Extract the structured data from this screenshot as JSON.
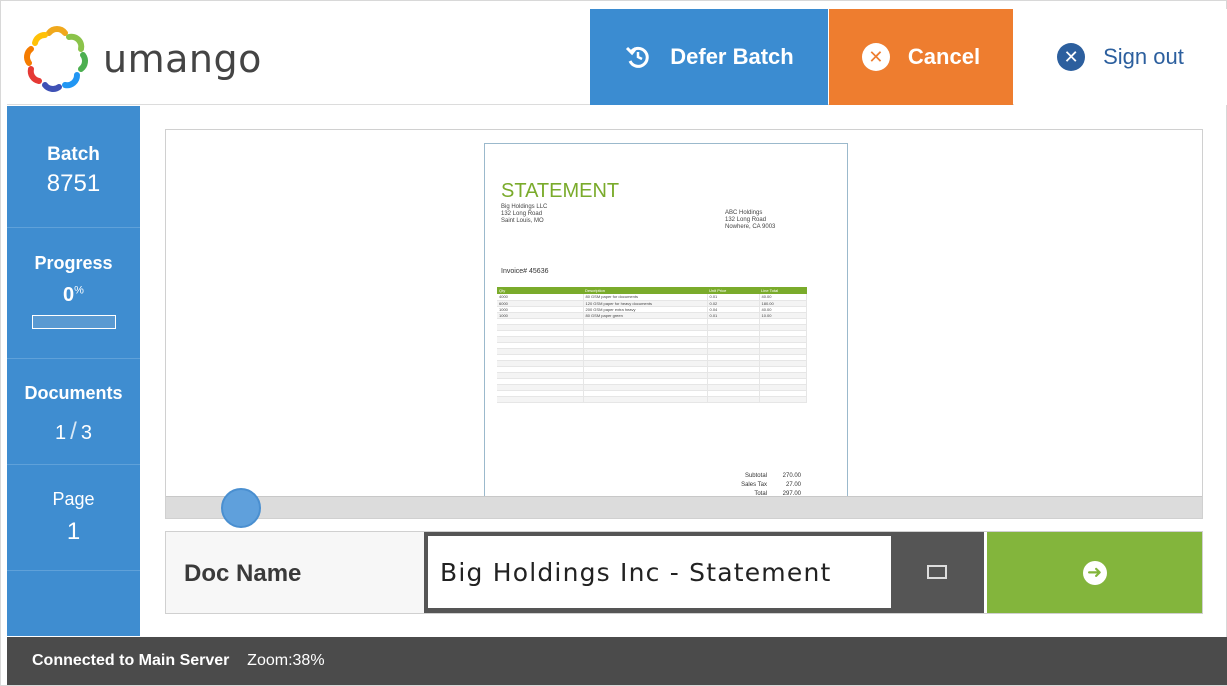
{
  "header": {
    "logo_text": "umango",
    "defer_label": "Defer Batch",
    "cancel_label": "Cancel",
    "signout_label": "Sign out",
    "colors": {
      "defer": "#3b8cd1",
      "cancel": "#ee7d2f",
      "signout": "#2c5f9e"
    }
  },
  "sidebar": {
    "batch_label": "Batch",
    "batch_value": "8751",
    "progress_label": "Progress",
    "progress_value": "0",
    "progress_unit": "%",
    "progress_fraction": 0,
    "documents_label": "Documents",
    "documents_current": "1",
    "documents_sep": "/",
    "documents_total": "3",
    "page_label": "Page",
    "page_value": "1"
  },
  "document": {
    "title": "STATEMENT",
    "from_lines": [
      "Big Holdings LLC",
      "132 Long Road",
      "Saint Louis, MO"
    ],
    "to_lines": [
      "ABC Holdings",
      "132 Long Road",
      "Nowhere, CA 9003"
    ],
    "invoice": "Invoice# 45636",
    "table_headers": [
      "Qty",
      "Description",
      "Unit Price",
      "Line Total"
    ],
    "rows": [
      [
        "4000",
        "80 GSM paper for documents",
        "0.01",
        "40.00"
      ],
      [
        "6000",
        "120 GSM paper for heavy documents",
        "0.02",
        "180.00"
      ],
      [
        "1000",
        "200 GSM paper extra heavy",
        "0.04",
        "40.00"
      ],
      [
        "1000",
        "80 GSM paper green",
        "0.01",
        "10.00"
      ]
    ],
    "totals_labels": [
      "Subtotal",
      "Sales Tax",
      "Total"
    ],
    "totals_values": [
      "270.00",
      "27.00",
      "297.00"
    ]
  },
  "docname": {
    "label": "Doc Name",
    "value": "Big Holdings Inc - Statement"
  },
  "status": {
    "connected_prefix": "Connected to",
    "server": "Main Server",
    "zoom_label": "Zoom:",
    "zoom_value": "38%"
  }
}
